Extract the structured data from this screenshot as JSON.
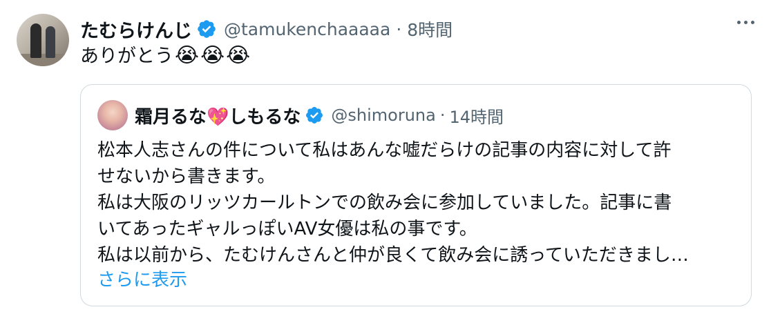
{
  "tweet": {
    "display_name": "たむらけんじ",
    "handle": "@tamukenchaaaaa",
    "separator": "·",
    "time": "8時間",
    "text": "ありがとう",
    "emojis": [
      "😭",
      "😭",
      "😭"
    ]
  },
  "quote": {
    "display_name_part1": "霜月るな",
    "heart_emoji": "💖",
    "display_name_part2": "しもるな",
    "handle": "@shimoruna",
    "separator": "·",
    "time": "14時間",
    "lines": [
      "松本人志さんの件について私はあんな嘘だらけの記事の内容に対して許",
      "せないから書きます。",
      "私は大阪のリッツカールトンでの飲み会に参加していました。記事に書",
      "いてあったギャルっぽいAV女優は私の事です。",
      "私は以前から、たむけんさんと仲が良くて飲み会に誘っていただきまし…"
    ],
    "show_more": "さらに表示"
  },
  "icons": {
    "verified": "verified-badge-icon",
    "more": "more-options-icon"
  },
  "colors": {
    "verified_blue": "#1d9bf0",
    "secondary_text": "#536471",
    "link": "#1d9bf0",
    "border": "#cfd9de"
  }
}
